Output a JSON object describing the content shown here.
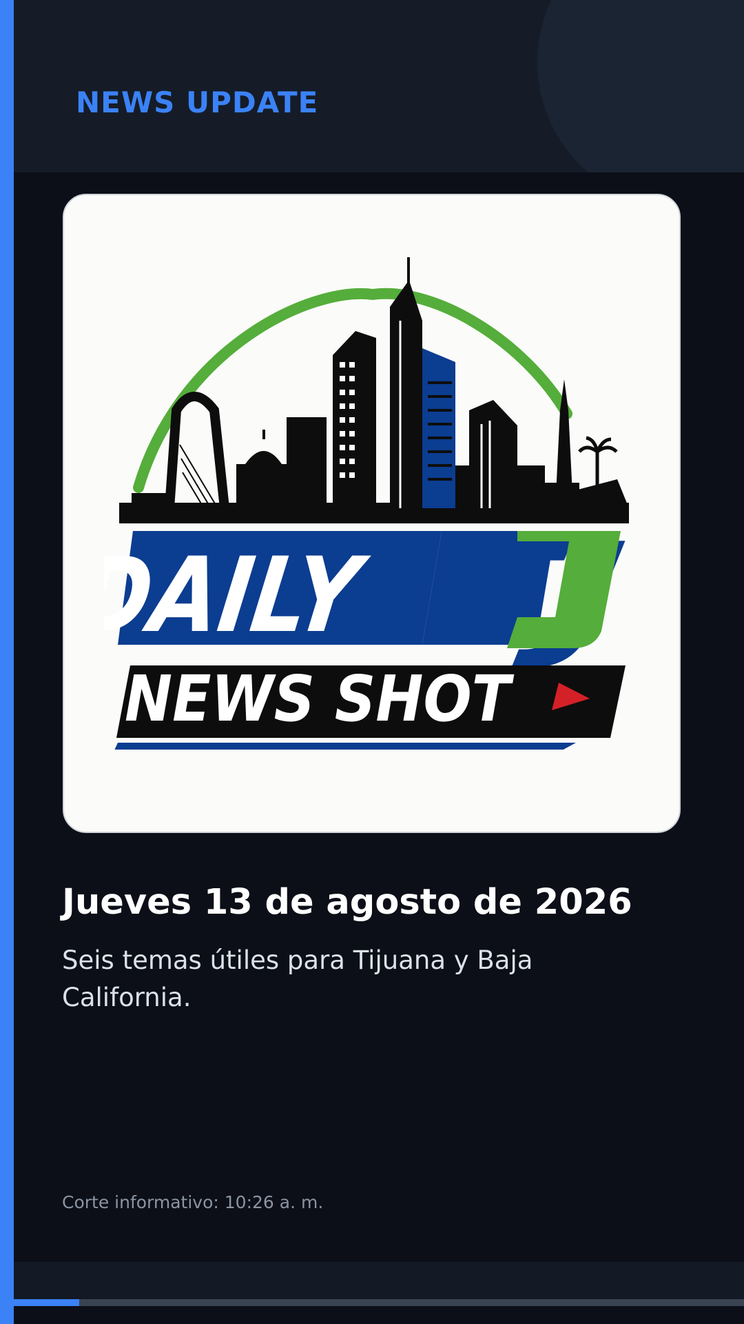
{
  "kicker": "NEWS UPDATE",
  "logo": {
    "line1_left": "DAILY",
    "line1_right": "TJ",
    "line2": "NEWS SHOT",
    "icon": "play-triangle-icon"
  },
  "headline": "Jueves 13 de agosto de 2026",
  "subheadline": "Seis temas útiles para Tijuana y Baja California.",
  "timestamp": "Corte informativo: 10:26 a. m.",
  "progress": {
    "fraction": 0.09
  },
  "colors": {
    "accent": "#3b82f6",
    "logo_blue": "#0b3d91",
    "logo_green": "#55ad3b",
    "logo_red": "#d42127",
    "background": "#0c0f17"
  }
}
